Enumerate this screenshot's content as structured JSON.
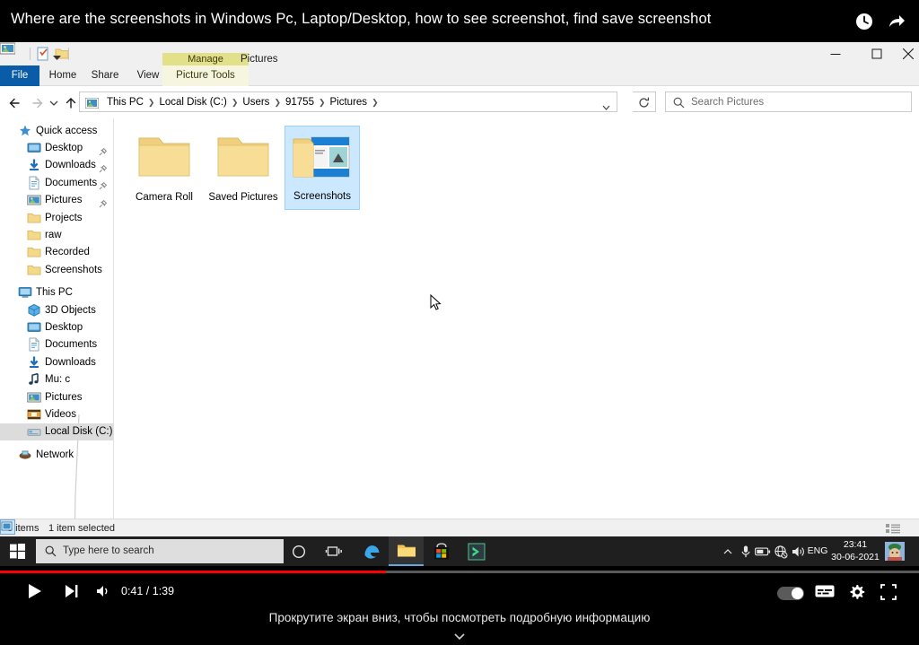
{
  "youtube": {
    "video_title": "Where are the screenshots in Windows Pc, Laptop/Desktop, how to see screenshot, find save screenshot",
    "watch_later_icon": "clock-icon",
    "share_icon": "share-arrow-icon",
    "player": {
      "current_time": "0:41",
      "duration": "1:39",
      "time_display": "0:41 / 1:39",
      "progress_percent": 42,
      "caption": "Прокрутите экран вниз, чтобы посмотреть подробную информацию",
      "play_icon": "play-icon",
      "next_icon": "next-track-icon",
      "volume_icon": "volume-icon",
      "autoplay_icon": "autoplay-toggle",
      "subtitles_icon": "subtitles-icon",
      "settings_icon": "gear-icon",
      "size_icon": "miniplayer-icon",
      "progress_color": "#ff0000"
    }
  },
  "explorer": {
    "quick_access_toolbar": {
      "app_icon": "pictures-folder-icon",
      "properties_icon": "properties-icon",
      "new_folder_icon": "new-folder-icon",
      "customize_icon": "chevron-down-icon"
    },
    "window_controls": {
      "minimize": "minimize-icon",
      "maximize": "maximize-icon",
      "close": "close-icon"
    },
    "ribbon": {
      "contextual_group": "Manage",
      "contextual_tab": "Picture Tools",
      "window_title": "Pictures",
      "tabs": [
        {
          "label": "File",
          "active": false,
          "accent": "#0b5ca8"
        },
        {
          "label": "Home",
          "active": false
        },
        {
          "label": "Share",
          "active": false
        },
        {
          "label": "View",
          "active": false
        }
      ],
      "expand_icon": "chevron-down-icon",
      "help_label": "?"
    },
    "addressbar": {
      "back_icon": "arrow-left-icon",
      "forward_icon": "arrow-right-icon",
      "history_icon": "chevron-down-icon",
      "up_icon": "arrow-up-icon",
      "path_icon": "pictures-folder-icon",
      "breadcrumbs": [
        "This PC",
        "Local Disk (C:)",
        "Users",
        "91755",
        "Pictures"
      ],
      "dropdown_icon": "chevron-down-icon",
      "refresh_icon": "refresh-icon"
    },
    "search": {
      "placeholder": "Search Pictures",
      "icon": "search-icon"
    },
    "sidebar": {
      "groups": [
        {
          "name": "quick-access",
          "header": {
            "label": "Quick access",
            "icon": "star-pin-icon"
          },
          "items": [
            {
              "label": "Desktop",
              "icon": "desktop-icon",
              "pinned": true
            },
            {
              "label": "Downloads",
              "icon": "downloads-icon",
              "pinned": true
            },
            {
              "label": "Documents",
              "icon": "documents-icon",
              "pinned": true
            },
            {
              "label": "Pictures",
              "icon": "pictures-icon",
              "pinned": true
            },
            {
              "label": "Projects",
              "icon": "folder-icon",
              "pinned": false
            },
            {
              "label": "raw",
              "icon": "folder-icon",
              "pinned": false
            },
            {
              "label": "Recorded",
              "icon": "folder-icon",
              "pinned": false
            },
            {
              "label": "Screenshots",
              "icon": "folder-icon",
              "pinned": false
            }
          ]
        },
        {
          "name": "this-pc",
          "header": {
            "label": "This PC",
            "icon": "computer-icon"
          },
          "items": [
            {
              "label": "3D Objects",
              "icon": "3d-objects-icon",
              "selected": false
            },
            {
              "label": "Desktop",
              "icon": "desktop-icon",
              "selected": false
            },
            {
              "label": "Documents",
              "icon": "documents-icon",
              "selected": false
            },
            {
              "label": "Downloads",
              "icon": "downloads-icon",
              "selected": false
            },
            {
              "label": "Mu: c",
              "icon": "music-icon",
              "selected": false
            },
            {
              "label": "Pictures",
              "icon": "pictures-icon",
              "selected": false
            },
            {
              "label": "Videos",
              "icon": "videos-icon",
              "selected": false
            },
            {
              "label": "Local Disk (C:)",
              "icon": "disk-icon",
              "selected": true
            }
          ]
        },
        {
          "name": "network",
          "header": {
            "label": "Network",
            "icon": "network-icon"
          },
          "items": []
        }
      ]
    },
    "files": [
      {
        "name": "Camera Roll",
        "icon": "folder-icon",
        "selected": false,
        "thumbnail": false
      },
      {
        "name": "Saved Pictures",
        "icon": "folder-icon",
        "selected": false,
        "thumbnail": false
      },
      {
        "name": "Screenshots",
        "icon": "folder-icon",
        "selected": true,
        "thumbnail": true
      }
    ],
    "cursor_icon": "mouse-pointer-icon",
    "statusbar": {
      "item_count": "3 items",
      "selection": "1 item selected",
      "details_view_icon": "details-view-icon",
      "icons_view_icon": "large-icons-view-icon",
      "active_view": "large-icons"
    }
  },
  "taskbar": {
    "start_icon": "windows-start-icon",
    "search_placeholder": "Type here to search",
    "search_icon": "search-icon",
    "items": [
      {
        "name": "cortana-icon",
        "active": false
      },
      {
        "name": "task-view-icon",
        "active": false
      },
      {
        "name": "edge-icon",
        "active": false
      },
      {
        "name": "file-explorer-icon",
        "active": true
      },
      {
        "name": "microsoft-store-icon",
        "active": false
      },
      {
        "name": "media-app-icon",
        "active": false
      }
    ],
    "tray": {
      "expand_icon": "chevron-up-icon",
      "mic_icon": "microphone-icon",
      "battery_icon": "battery-icon",
      "network_icon": "network-globe-icon",
      "volume_icon": "volume-icon",
      "language": "ENG",
      "time": "23:41",
      "date": "30-06-2021",
      "avatar_icon": "user-avatar"
    }
  }
}
